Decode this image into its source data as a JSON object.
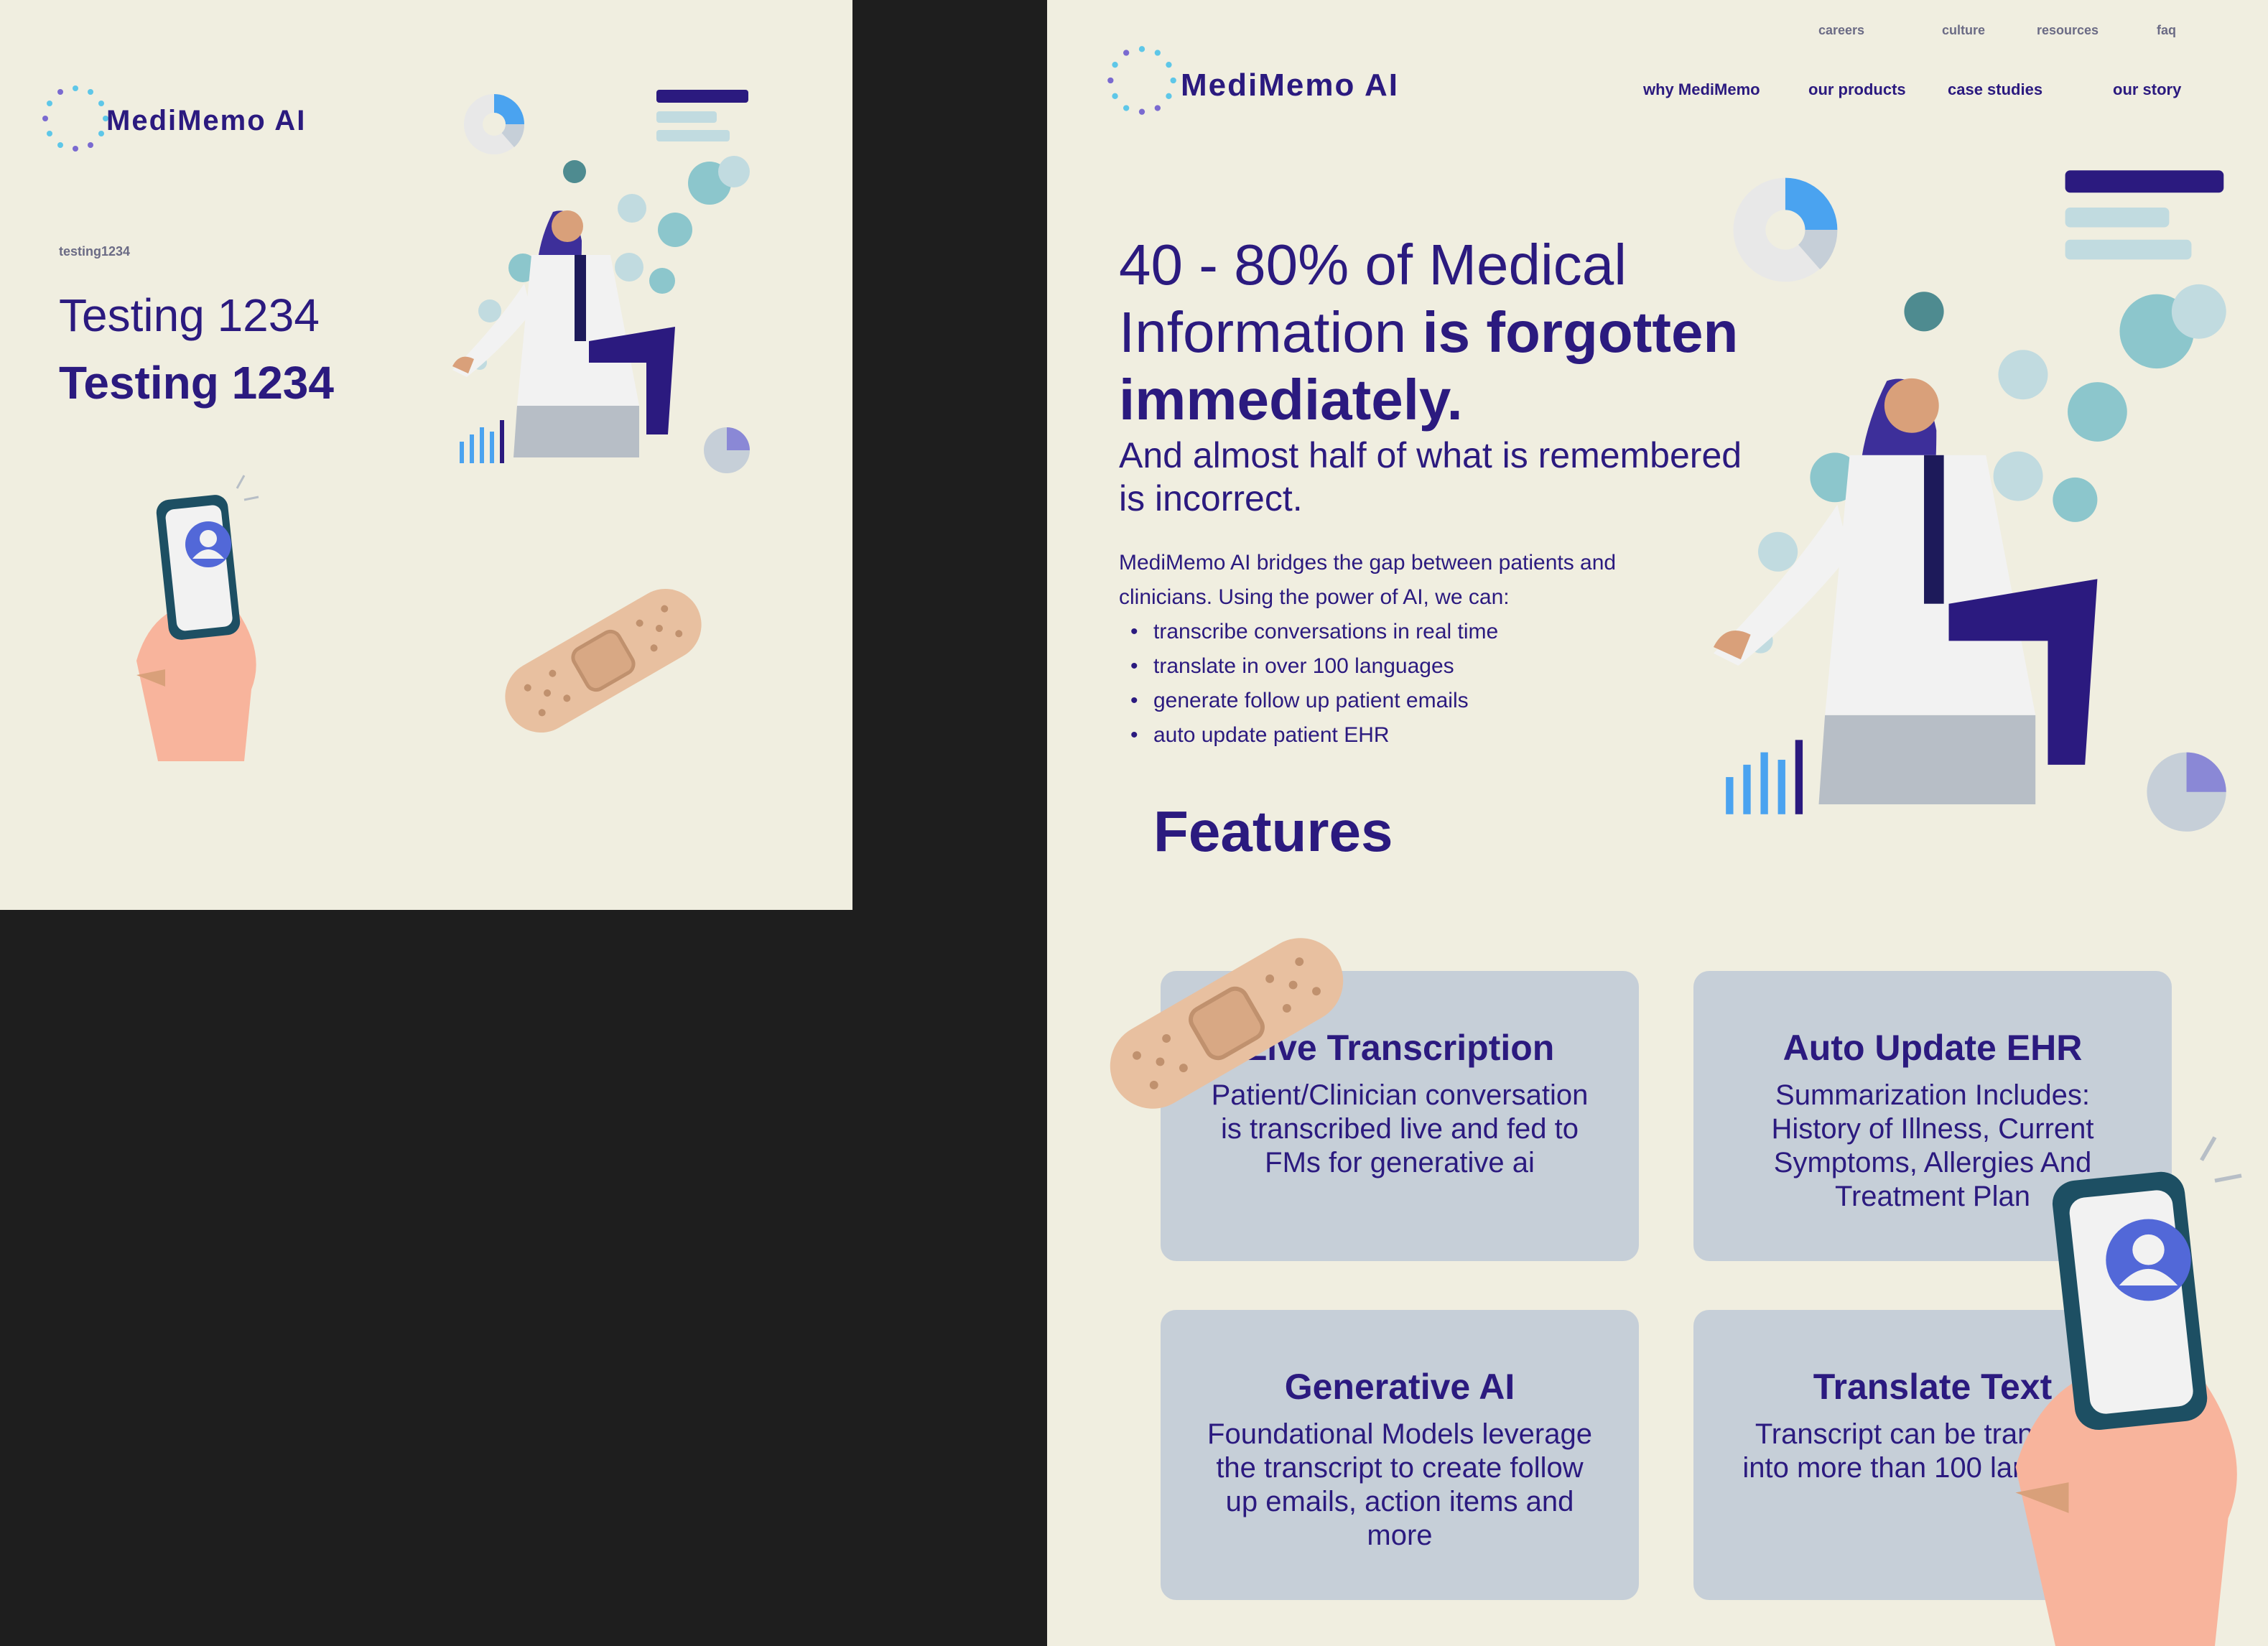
{
  "left_frame": {
    "logo_text": "MediMemo AI",
    "eyebrow": "testing1234",
    "heading_light": "Testing 1234",
    "heading_bold": "Testing 1234"
  },
  "right_frame": {
    "logo_text": "MediMemo AI",
    "top_nav": [
      "careers",
      "culture",
      "resources",
      "faq"
    ],
    "main_nav": [
      "why MediMemo",
      "our products",
      "case studies",
      "our story"
    ],
    "hero": {
      "line1": "40 - 80% of Medical",
      "line2_light": "Information",
      "line2_bold": "is forgotten",
      "line3_bold": "immediately.",
      "sub1": "And almost half of what is remembered",
      "sub2": "is incorrect."
    },
    "intro": {
      "line1": "MediMemo AI bridges the gap between patients and",
      "line2": "clinicians. Using the power of AI, we can:",
      "bullets": [
        "transcribe conversations in real time",
        "translate in over 100 languages",
        "generate follow up patient emails",
        "auto update patient EHR"
      ]
    },
    "features_title": "Features",
    "cards": [
      {
        "title": "Live Transcription",
        "body": "Patient/Clinician conversation is transcribed live and fed to FMs for generative ai"
      },
      {
        "title": "Auto Update EHR",
        "body": "Summarization Includes: History of Illness, Current Symptoms, Allergies And Treatment Plan"
      },
      {
        "title": "Generative AI",
        "body": "Foundational Models leverage the transcript to create follow up emails, action items and more"
      },
      {
        "title": "Translate Text",
        "body": "Transcript can be translated into more than 100 languages"
      }
    ]
  },
  "colors": {
    "background": "#f0eee0",
    "canvas": "#1e1e1e",
    "brand_purple": "#2b1a7f",
    "card": "#c6cfd8",
    "teal": "#8cc6cc",
    "blue_accent": "#4aa3f0"
  }
}
